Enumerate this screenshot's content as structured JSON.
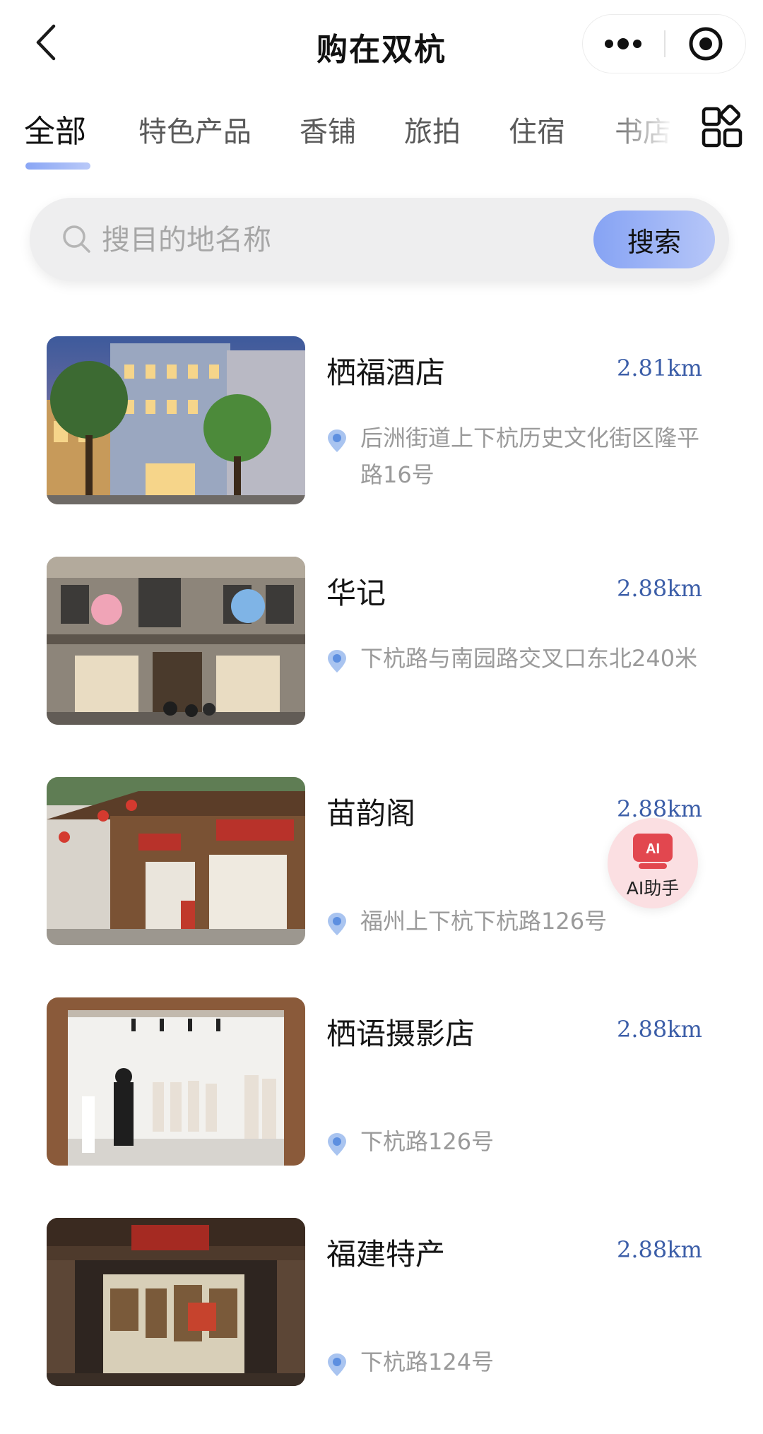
{
  "nav": {
    "title": "购在双杭"
  },
  "tabs": [
    {
      "label": "全部",
      "active": true
    },
    {
      "label": "特色产品",
      "active": false
    },
    {
      "label": "香铺",
      "active": false
    },
    {
      "label": "旅拍",
      "active": false
    },
    {
      "label": "住宿",
      "active": false
    },
    {
      "label": "书店",
      "active": false
    }
  ],
  "search": {
    "placeholder": "搜目的地名称",
    "button_label": "搜索"
  },
  "places": [
    {
      "name": "栖福酒店",
      "distance": "2.81km",
      "address": "后洲街道上下杭历史文化街区隆平路16号"
    },
    {
      "name": "华记",
      "distance": "2.88km",
      "address": "下杭路与南园路交叉口东北240米"
    },
    {
      "name": "苗韵阁",
      "distance": "2.88km",
      "address": "福州上下杭下杭路126号"
    },
    {
      "name": "栖语摄影店",
      "distance": "2.88km",
      "address": "下杭路126号"
    },
    {
      "name": "福建特产",
      "distance": "2.88km",
      "address": "下杭路124号"
    }
  ],
  "ai_assistant": {
    "label": "AI助手",
    "icon_text": "AI"
  },
  "colors": {
    "accent": "#8aa6f5",
    "distance": "#3c5ea8",
    "pin": "#8fb4ec",
    "ai_bg": "#fbdfe2",
    "ai_icon": "#e2474f"
  },
  "icons": [
    "back-arrow-icon",
    "more-dots-icon",
    "close-target-icon",
    "grid-menu-icon",
    "search-icon",
    "location-pin-icon",
    "ai-assistant-icon"
  ]
}
